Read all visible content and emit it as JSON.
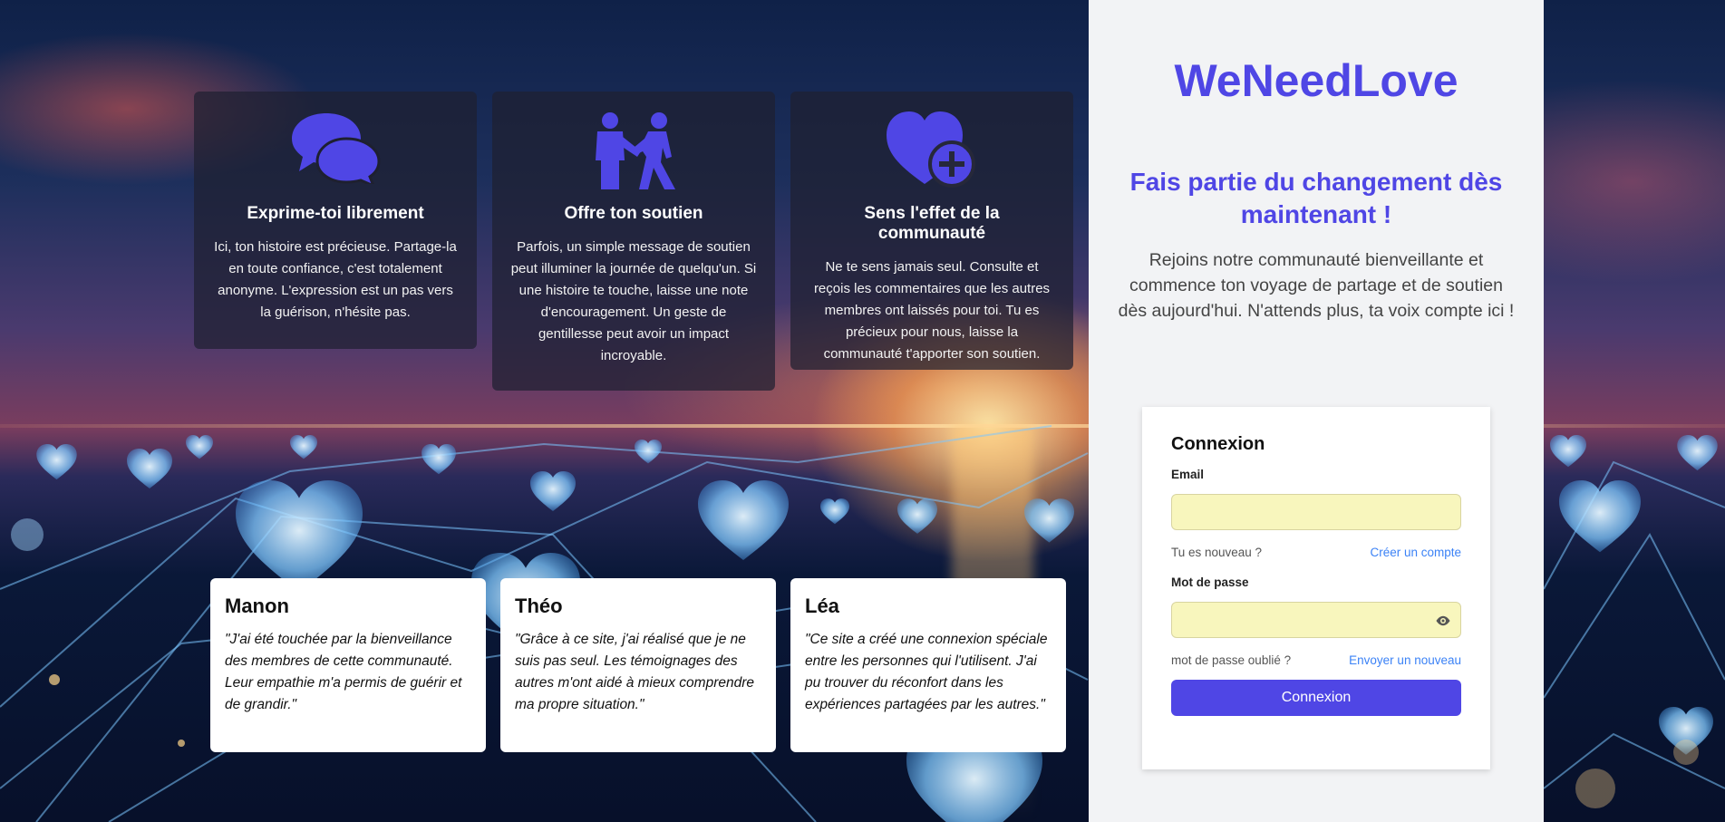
{
  "brand": "WeNeedLove",
  "colors": {
    "accent": "#4f46e5",
    "link": "#3b82f6",
    "input_bg": "#f8f6bd"
  },
  "features": [
    {
      "icon": "chat-bubbles-icon",
      "title": "Exprime-toi librement",
      "text": "Ici, ton histoire est précieuse. Partage-la en toute confiance, c'est totalement anonyme. L'expression est un pas vers la guérison, n'hésite pas."
    },
    {
      "icon": "helping-people-icon",
      "title": "Offre ton soutien",
      "text": "Parfois, un simple message de soutien peut illuminer la journée de quelqu'un. Si une histoire te touche, laisse une note d'encouragement. Un geste de gentillesse peut avoir un impact incroyable."
    },
    {
      "icon": "heart-plus-icon",
      "title": "Sens l'effet de la communauté",
      "text": "Ne te sens jamais seul. Consulte et reçois les commentaires que les autres membres ont laissés pour toi. Tu es précieux pour nous, laisse la communauté t'apporter son soutien."
    }
  ],
  "testimonials": [
    {
      "name": "Manon",
      "quote": "\"J'ai été touchée par la bienveillance des membres de cette communauté. Leur empathie m'a permis de guérir et de grandir.\""
    },
    {
      "name": "Théo",
      "quote": "\"Grâce à ce site, j'ai réalisé que je ne suis pas seul. Les témoignages des autres m'ont aidé à mieux comprendre ma propre situation.\""
    },
    {
      "name": "Léa",
      "quote": "\"Ce site a créé une connexion spéciale entre les personnes qui l'utilisent. J'ai pu trouver du réconfort dans les expériences partagées par les autres.\""
    }
  ],
  "panel": {
    "tagline": "Fais partie du changement dès maintenant !",
    "intro": "Rejoins notre communauté bienveillante et commence ton voyage de partage et de soutien dès aujourd'hui. N'attends plus, ta voix compte ici !"
  },
  "login": {
    "title": "Connexion",
    "email_label": "Email",
    "email_value": "",
    "new_user_text": "Tu es nouveau ?",
    "create_account_link": "Créer un compte",
    "password_label": "Mot de passe",
    "password_value": "",
    "forgot_text": "mot de passe oublié ?",
    "send_new_link": "Envoyer un nouveau",
    "submit_label": "Connexion"
  }
}
